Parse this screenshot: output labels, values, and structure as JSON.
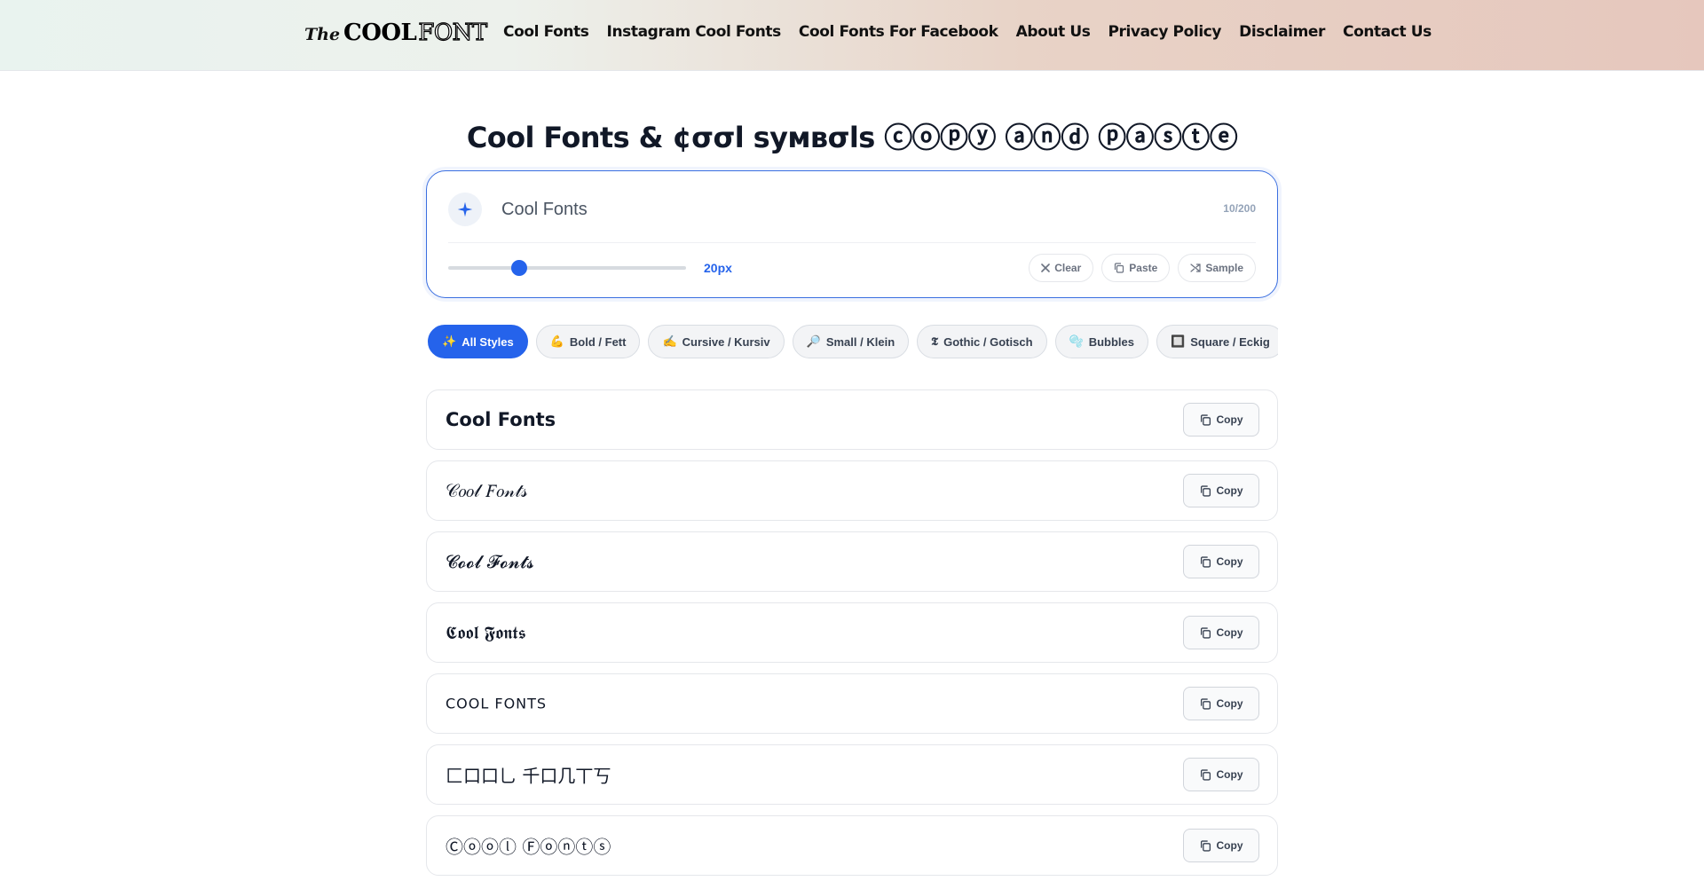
{
  "header": {
    "logo": {
      "prefix": "The",
      "bold": "COOL",
      "outline": "FONT"
    },
    "nav": [
      "Cool Fonts",
      "Instagram Cool Fonts",
      "Cool Fonts For Facebook",
      "About Us",
      "Privacy Policy",
      "Disclaimer",
      "Contact Us"
    ]
  },
  "page_title": "Cool Fonts & ¢σσl ѕумвσls ⓒⓞⓟⓨ ⓐⓝⓓ ⓟⓐⓢⓣⓔ",
  "input": {
    "value": "Cool Fonts",
    "counter": "10/200",
    "size_label": "20px",
    "slider_level": 0.3,
    "buttons": {
      "clear": "Clear",
      "paste": "Paste",
      "sample": "Sample"
    }
  },
  "filters": [
    {
      "icon": "✨",
      "label": "All Styles",
      "active": true
    },
    {
      "icon": "💪",
      "label": "Bold / Fett"
    },
    {
      "icon": "✍️",
      "label": "Cursive / Kursiv"
    },
    {
      "icon": "🔎",
      "label": "Small / Klein"
    },
    {
      "icon": "𝕿",
      "label": "Gothic / Gotisch"
    },
    {
      "icon": "🫧",
      "label": "Bubbles"
    },
    {
      "icon": "🔲",
      "label": "Square / Eckig"
    }
  ],
  "results": [
    {
      "text": "Cool Fonts",
      "style": "bold-style"
    },
    {
      "text": "𝒞𝑜𝑜𝓁 𝐹𝑜𝓃𝓉𝓈",
      "style": ""
    },
    {
      "text": "𝓒𝓸𝓸𝓵 𝓕𝓸𝓷𝓽𝓼",
      "style": ""
    },
    {
      "text": "𝕮𝖔𝖔𝖑 𝕱𝖔𝖓𝖙𝖘",
      "style": ""
    },
    {
      "text": "COOL FONTS",
      "style": "small-style"
    },
    {
      "text": "匚口口乚 千口几丅丂",
      "style": ""
    },
    {
      "text": "Ⓒⓞⓞⓛ Ⓕⓞⓝⓣⓢ",
      "style": ""
    }
  ],
  "copy_label": "Copy",
  "colors": {
    "accent": "#2563eb",
    "border": "#e5e7eb"
  }
}
